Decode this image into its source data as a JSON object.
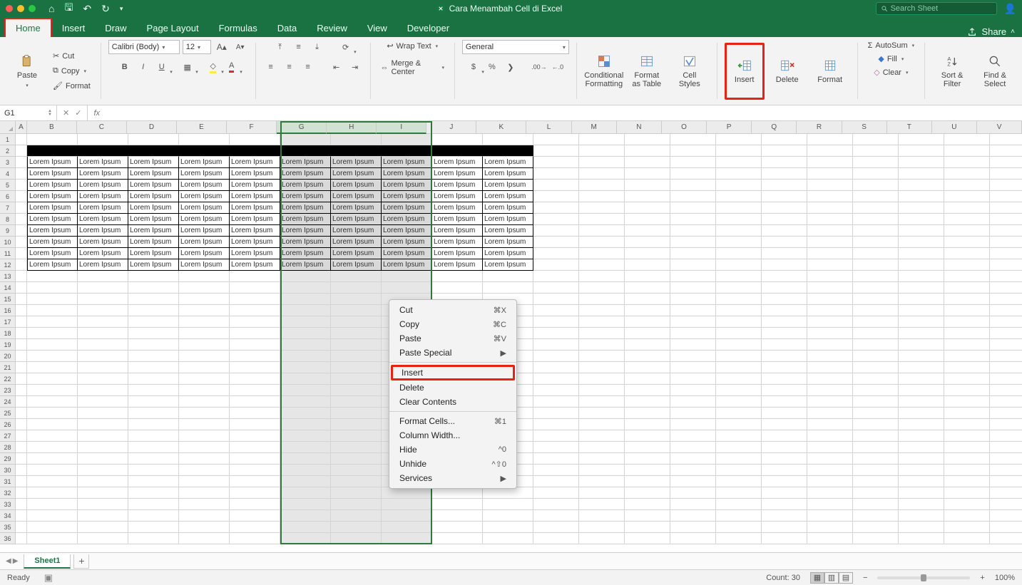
{
  "window": {
    "title": "Cara Menambah Cell di Excel"
  },
  "search": {
    "placeholder": "Search Sheet"
  },
  "tabs": {
    "items": [
      "Home",
      "Insert",
      "Draw",
      "Page Layout",
      "Formulas",
      "Data",
      "Review",
      "View",
      "Developer"
    ],
    "active": "Home",
    "share": "Share"
  },
  "ribbon": {
    "paste": "Paste",
    "cut": "Cut",
    "copy": "Copy",
    "format_pt": "Format",
    "font_name": "Calibri (Body)",
    "font_size": "12",
    "wrap": "Wrap Text",
    "merge": "Merge & Center",
    "num_format": "General",
    "cond_fmt": "Conditional\nFormatting",
    "fmt_table": "Format\nas Table",
    "cell_styles": "Cell\nStyles",
    "insert": "Insert",
    "delete": "Delete",
    "format": "Format",
    "autosum": "AutoSum",
    "fill": "Fill",
    "clear": "Clear",
    "sort": "Sort &\nFilter",
    "find": "Find &\nSelect"
  },
  "namebox": {
    "ref": "G1"
  },
  "grid": {
    "columns": [
      "A",
      "B",
      "C",
      "D",
      "E",
      "F",
      "G",
      "H",
      "I",
      "J",
      "K",
      "L",
      "M",
      "N",
      "O",
      "P",
      "Q",
      "R",
      "S",
      "T",
      "U",
      "V"
    ],
    "sel_cols": [
      "G",
      "H",
      "I"
    ],
    "row_count": 36,
    "data_rows_start": 3,
    "data_rows_end": 12,
    "first_data_col": "B",
    "last_data_col": "K",
    "cell_text": "Lorem Ipsum"
  },
  "context": {
    "items": [
      {
        "label": "Cut",
        "shortcut": "⌘X"
      },
      {
        "label": "Copy",
        "shortcut": "⌘C"
      },
      {
        "label": "Paste",
        "shortcut": "⌘V"
      },
      {
        "label": "Paste Special",
        "arrow": true
      },
      {
        "sep": true
      },
      {
        "label": "Insert",
        "highlighted": true
      },
      {
        "label": "Delete"
      },
      {
        "label": "Clear Contents"
      },
      {
        "sep": true
      },
      {
        "label": "Format Cells...",
        "shortcut": "⌘1"
      },
      {
        "label": "Column Width..."
      },
      {
        "label": "Hide",
        "shortcut": "^0"
      },
      {
        "label": "Unhide",
        "shortcut": "^⇧0"
      },
      {
        "label": "Services",
        "arrow": true
      }
    ]
  },
  "sheets": {
    "name": "Sheet1"
  },
  "status": {
    "ready": "Ready",
    "count_label": "Count:",
    "count_value": "30",
    "zoom": "100%"
  }
}
